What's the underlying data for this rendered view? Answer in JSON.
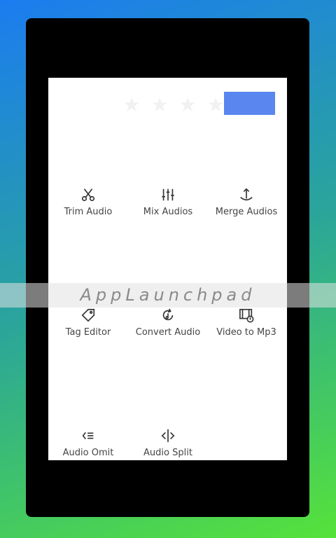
{
  "rating": {
    "stars": 4,
    "filled": 0
  },
  "tools": [
    {
      "label": "Trim Audio",
      "icon": "scissors-icon"
    },
    {
      "label": "Mix Audios",
      "icon": "equalizer-icon"
    },
    {
      "label": "Merge Audios",
      "icon": "merge-icon"
    },
    {
      "label": "Tag Editor",
      "icon": "tag-icon"
    },
    {
      "label": "Convert Audio",
      "icon": "convert-icon"
    },
    {
      "label": "Video to Mp3",
      "icon": "video-music-icon"
    },
    {
      "label": "Audio Omit",
      "icon": "omit-icon"
    },
    {
      "label": "Audio Split",
      "icon": "split-icon"
    }
  ],
  "watermark": "AppLaunchpad",
  "colors": {
    "accent": "#5a86ef",
    "icon": "#333333"
  }
}
